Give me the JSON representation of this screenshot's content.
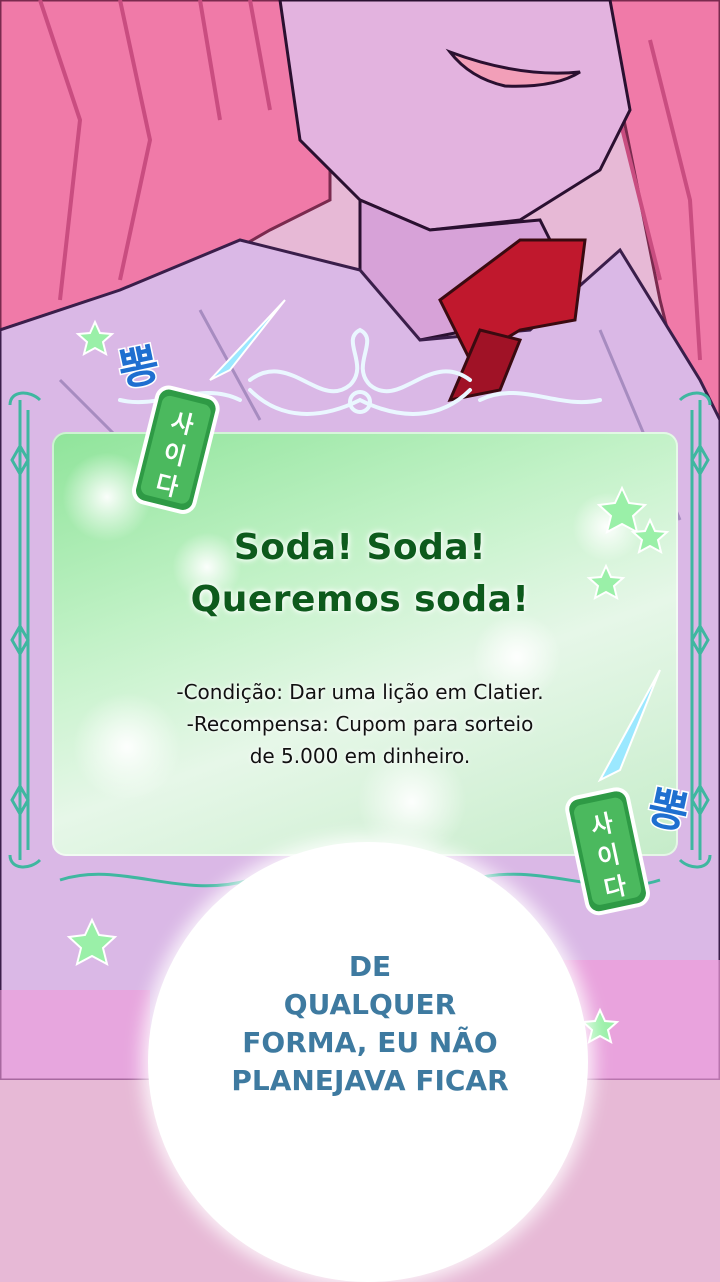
{
  "panel": {
    "title_lines": [
      "Soda! Soda!",
      "Queremos soda!"
    ],
    "detail_lines": [
      "-Condição: Dar uma lição em Clatier.",
      "-Recompensa: Cupom para sorteio",
      "de 5.000 em dinheiro."
    ]
  },
  "sound_effect": {
    "text": "뽕",
    "can_label": [
      "사",
      "이",
      "다"
    ]
  },
  "speech_bubble": {
    "lines": [
      "DE",
      "QUALQUER",
      "FORMA, EU NÃO",
      "PLANEJAVA FICAR"
    ]
  },
  "colors": {
    "panel_green": "#8fe49a",
    "title_green": "#0d5a1c",
    "speech_blue": "#3e7aa0",
    "hair_pink": "#f07aa8",
    "bow_red": "#c0182d",
    "can_green": "#2e9a45"
  },
  "icons": [
    "soda-can-icon",
    "star-icon",
    "ornament-frame"
  ]
}
